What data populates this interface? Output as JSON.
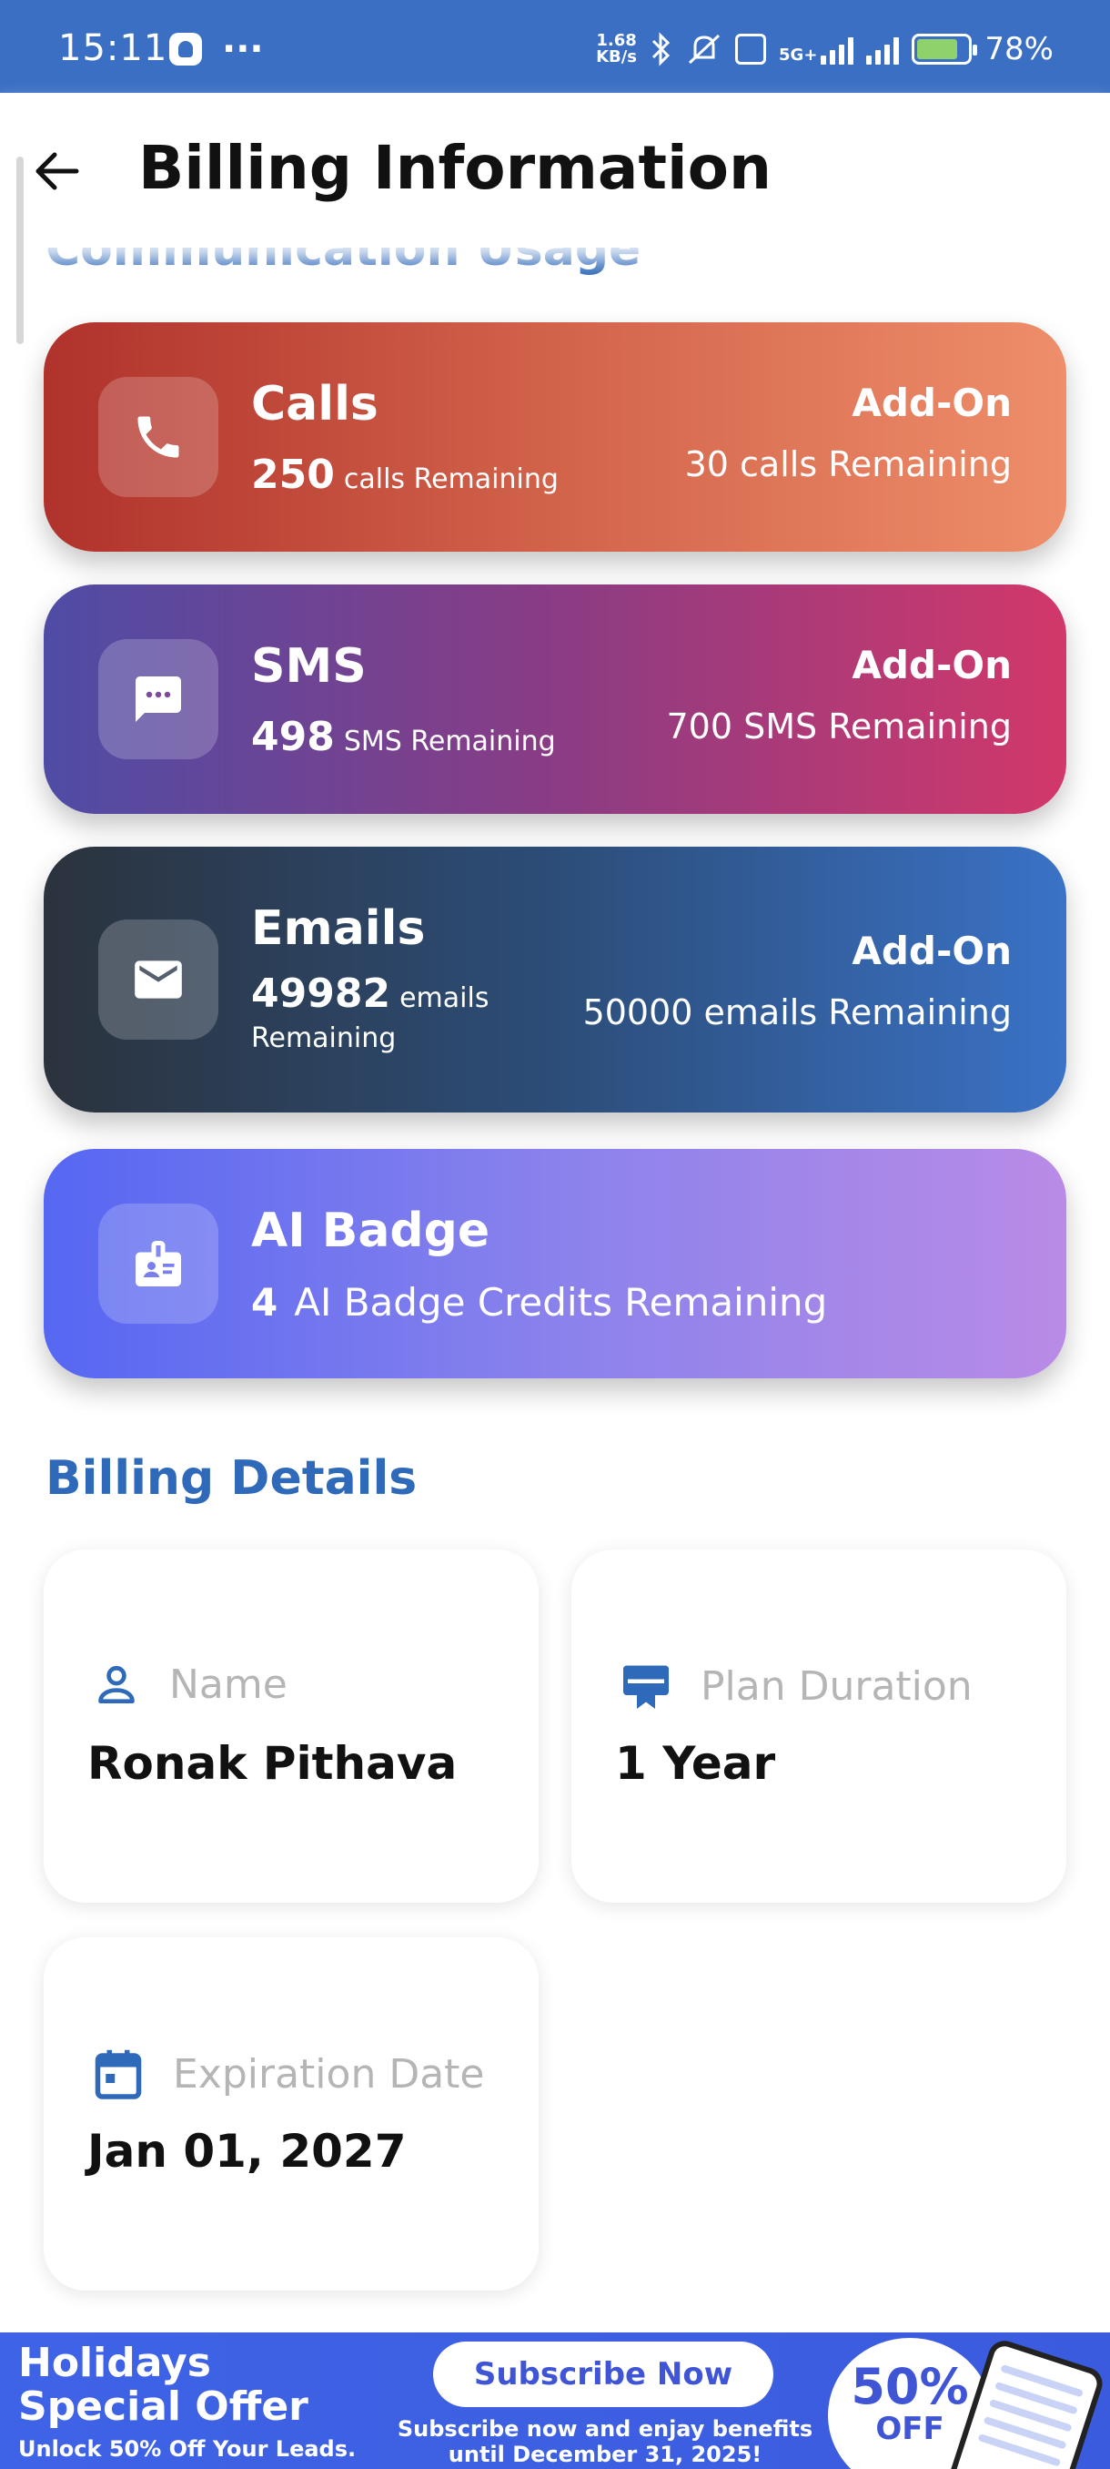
{
  "status_bar": {
    "time": "15:11",
    "net_speed_value": "1.68",
    "net_speed_unit": "KB/s",
    "network_type": "5G+",
    "battery": "78%",
    "battery_level": 0.78
  },
  "header": {
    "title": "Billing Information"
  },
  "sections": {
    "communication_usage": "Communication Usage",
    "billing_details": "Billing Details"
  },
  "usage_cards": {
    "calls": {
      "title": "Calls",
      "count": "250",
      "unit": "calls Remaining",
      "addon_label": "Add-On",
      "addon_remaining": "30 calls Remaining"
    },
    "sms": {
      "title": "SMS",
      "count": "498",
      "unit": "SMS Remaining",
      "addon_label": "Add-On",
      "addon_remaining": "700 SMS Remaining"
    },
    "emails": {
      "title": "Emails",
      "count": "49982",
      "unit": "emails Remaining",
      "addon_label": "Add-On",
      "addon_remaining": "50000 emails Remaining"
    },
    "ai_badge": {
      "title": "AI Badge",
      "count": "4",
      "unit": "AI Badge Credits Remaining"
    }
  },
  "billing_details": {
    "name": {
      "label": "Name",
      "value": "Ronak Pithava"
    },
    "plan_duration": {
      "label": "Plan Duration",
      "value": "1 Year"
    },
    "expiration_date": {
      "label": "Expiration Date",
      "value": "Jan 01, 2027"
    }
  },
  "promo": {
    "title_line1": "Holidays",
    "title_line2": "Special Offer",
    "subtitle": "Unlock 50% Off Your Leads.",
    "button_label": "Subscribe Now",
    "description": "Subscribe now and enjay benefits until December 31, 2025!",
    "badge_percent": "50%",
    "badge_off": "OFF"
  },
  "colors": {
    "accent": "#2f69b9",
    "status_bar": "#3a6fc4",
    "calls_gradient": [
      "#b0322c",
      "#ee8e6a"
    ],
    "sms_gradient": [
      "#4f4ca5",
      "#d2386a"
    ],
    "emails_gradient": [
      "#2b333d",
      "#3a72c6"
    ],
    "ai_gradient": [
      "#5667f2",
      "#b98be6"
    ]
  },
  "icons": [
    "back-arrow-icon",
    "phone-icon",
    "chat-bubble-icon",
    "mail-icon",
    "badge-icon",
    "person-icon",
    "card-icon",
    "calendar-icon"
  ]
}
